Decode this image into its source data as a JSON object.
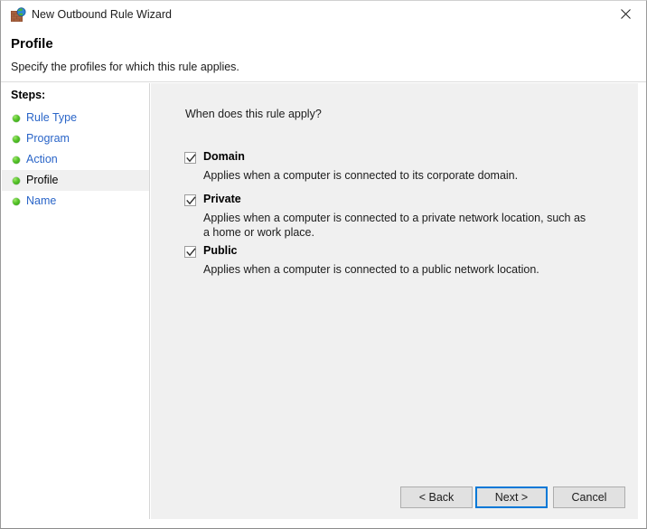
{
  "window": {
    "title": "New Outbound Rule Wizard",
    "icon": "firewall-globe-icon",
    "close_label": "✕"
  },
  "header": {
    "title": "Profile",
    "subtitle": "Specify the profiles for which this rule applies."
  },
  "sidebar": {
    "label": "Steps:",
    "items": [
      {
        "label": "Rule Type",
        "current": false
      },
      {
        "label": "Program",
        "current": false
      },
      {
        "label": "Action",
        "current": false
      },
      {
        "label": "Profile",
        "current": true
      },
      {
        "label": "Name",
        "current": false
      }
    ]
  },
  "main": {
    "question": "When does this rule apply?",
    "profiles": [
      {
        "name": "Domain",
        "checked": true,
        "description": "Applies when a computer is connected to its corporate domain."
      },
      {
        "name": "Private",
        "checked": true,
        "description": "Applies when a computer is connected to a private network location, such as a home or work place."
      },
      {
        "name": "Public",
        "checked": true,
        "description": "Applies when a computer is connected to a public network location."
      }
    ]
  },
  "footer": {
    "back_label": "< Back",
    "next_label": "Next >",
    "cancel_label": "Cancel"
  },
  "colors": {
    "link": "#2a65c8",
    "focus_border": "#0078d7",
    "panel_bg": "#f0f0f0",
    "button_bg": "#e1e1e1"
  }
}
